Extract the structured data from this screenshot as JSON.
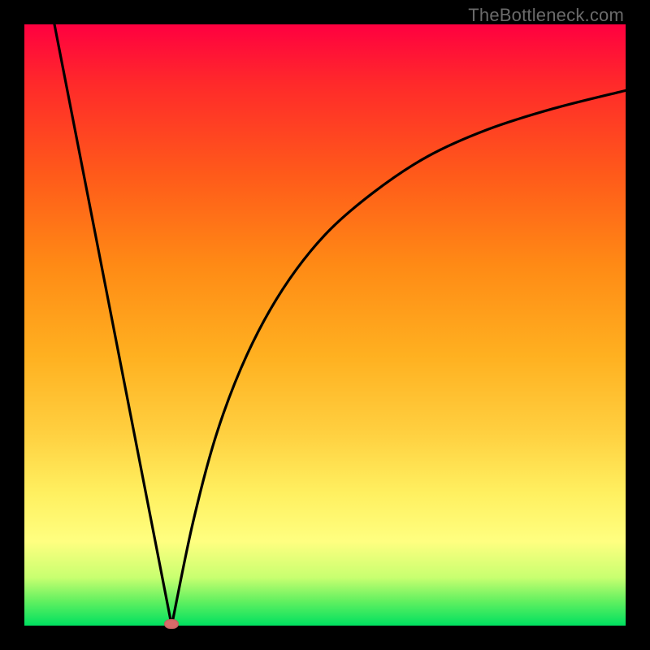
{
  "watermark": "TheBottleneck.com",
  "colors": {
    "background": "#000000",
    "curve": "#000000",
    "marker": "#d86a6a",
    "gradient_top": "#ff0040",
    "gradient_bottom": "#00e060"
  },
  "chart_data": {
    "type": "line",
    "title": "",
    "xlabel": "",
    "ylabel": "",
    "xlim": [
      0,
      100
    ],
    "ylim": [
      0,
      100
    ],
    "grid": false,
    "legend": false,
    "series": [
      {
        "name": "left-branch",
        "x": [
          5,
          10,
          15,
          20,
          24.5
        ],
        "values": [
          100,
          74,
          49,
          24,
          0
        ]
      },
      {
        "name": "right-branch",
        "x": [
          24.5,
          28,
          32,
          37,
          43,
          50,
          58,
          67,
          77,
          88,
          100
        ],
        "values": [
          0,
          17,
          32,
          45,
          56,
          65,
          72,
          78,
          82.5,
          86,
          89
        ]
      }
    ],
    "markers": [
      {
        "name": "min-point",
        "x": 24.5,
        "y": 0
      }
    ]
  }
}
